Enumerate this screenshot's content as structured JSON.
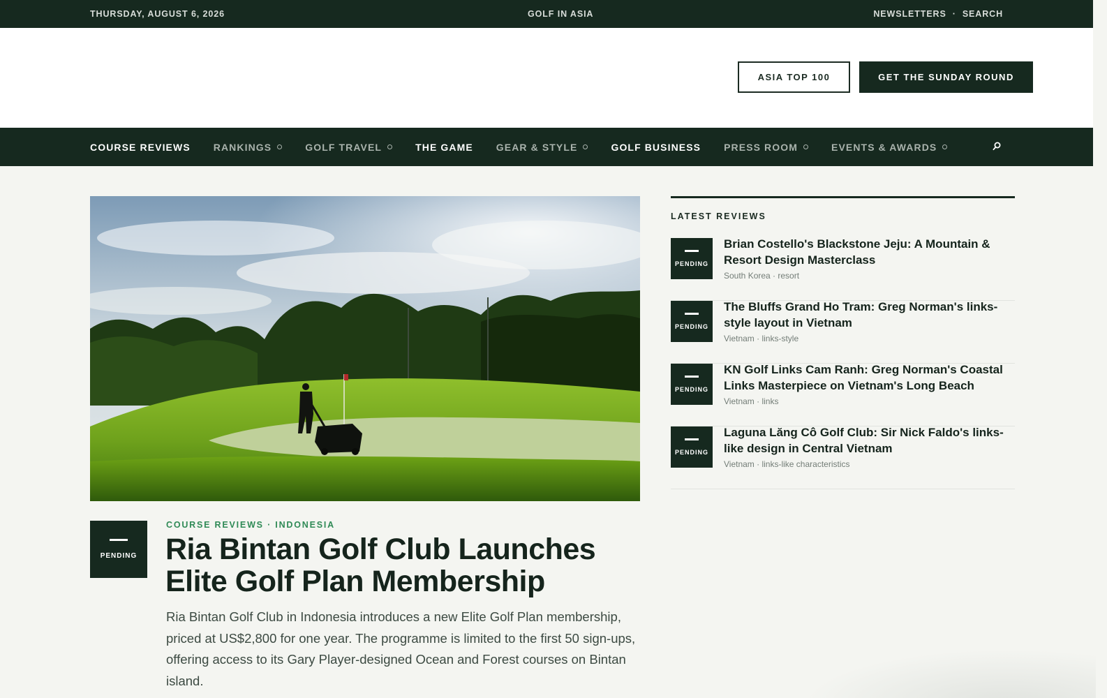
{
  "topbar": {
    "date": "THURSDAY, AUGUST 6, 2026",
    "site_name": "GOLF IN ASIA",
    "links": [
      "NEWSLETTERS",
      "·",
      "SEARCH"
    ]
  },
  "masthead": {
    "asia_top_100": "ASIA TOP 100",
    "sunday_round": "GET THE SUNDAY ROUND"
  },
  "nav": {
    "items": [
      {
        "label": "COURSE REVIEWS",
        "dropdown": false
      },
      {
        "label": "RANKINGS",
        "dropdown": true
      },
      {
        "label": "GOLF TRAVEL",
        "dropdown": true
      },
      {
        "label": "THE GAME",
        "dropdown": false
      },
      {
        "label": "GEAR & STYLE",
        "dropdown": true
      },
      {
        "label": "GOLF BUSINESS",
        "dropdown": false
      },
      {
        "label": "PRESS ROOM",
        "dropdown": true
      },
      {
        "label": "EVENTS & AWARDS",
        "dropdown": true
      }
    ],
    "search_icon": "search-icon"
  },
  "hero": {
    "badge": "PENDING",
    "meta": "COURSE REVIEWS · INDONESIA",
    "title": "Ria Bintan Golf Club Launches Elite Golf Plan Membership",
    "summary": "Ria Bintan Golf Club in Indonesia introduces a new Elite Golf Plan membership, priced at US$2,800 for one year. The programme is limited to the first 50 sign-ups, offering access to its Gary Player-designed Ocean and Forest courses on Bintan island."
  },
  "sidebar": {
    "heading": "LATEST REVIEWS",
    "reviews": [
      {
        "badge": "PENDING",
        "title": "Brian Costello's Blackstone Jeju: A Mountain & Resort Design Masterclass",
        "meta": "South Korea · resort"
      },
      {
        "badge": "PENDING",
        "title": "The Bluffs Grand Ho Tram: Greg Norman's links-style layout in Vietnam",
        "meta": "Vietnam · links-style"
      },
      {
        "badge": "PENDING",
        "title": "KN Golf Links Cam Ranh: Greg Norman's Coastal Links Masterpiece on Vietnam's Long Beach",
        "meta": "Vietnam · links"
      },
      {
        "badge": "PENDING",
        "title": "Laguna Lăng Cô Golf Club: Sir Nick Faldo's links-like design in Central Vietnam",
        "meta": "Vietnam · links-like characteristics"
      }
    ]
  },
  "colors": {
    "dark_green": "#16291f",
    "accent_green": "#2f8a56",
    "page_bg": "#f4f5f1"
  }
}
